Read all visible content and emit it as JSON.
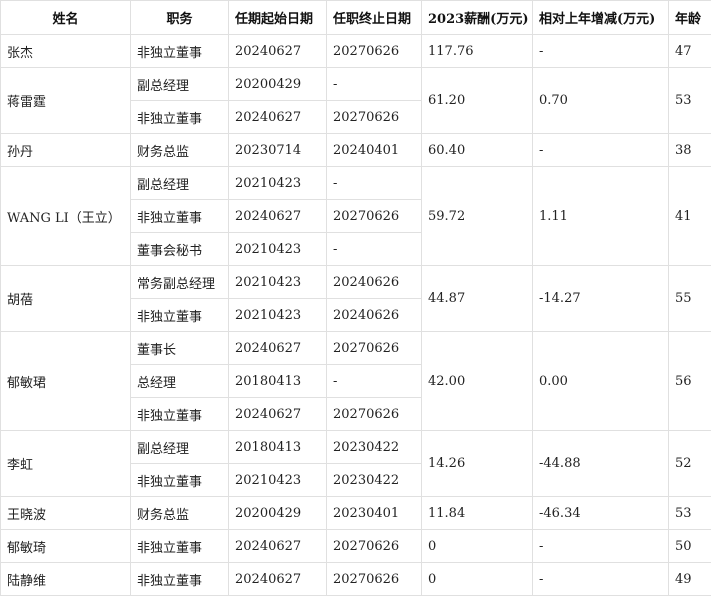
{
  "table": {
    "headers": [
      "姓名",
      "职务",
      "任期起始日期",
      "任职终止日期",
      "2023薪酬(万元)",
      "相对上年增减(万元)",
      "年龄"
    ],
    "people": [
      {
        "name": "张杰",
        "salary": "117.76",
        "change": "-",
        "age": "47",
        "roles": [
          {
            "title": "非独立董事",
            "start": "20240627",
            "end": "20270626"
          }
        ]
      },
      {
        "name": "蒋雷霆",
        "salary": "61.20",
        "change": "0.70",
        "age": "53",
        "roles": [
          {
            "title": "副总经理",
            "start": "20200429",
            "end": "-"
          },
          {
            "title": "非独立董事",
            "start": "20240627",
            "end": "20270626"
          }
        ]
      },
      {
        "name": "孙丹",
        "salary": "60.40",
        "change": "-",
        "age": "38",
        "roles": [
          {
            "title": "财务总监",
            "start": "20230714",
            "end": "20240401"
          }
        ]
      },
      {
        "name": "WANG LI（王立）",
        "salary": "59.72",
        "change": "1.11",
        "age": "41",
        "roles": [
          {
            "title": "副总经理",
            "start": "20210423",
            "end": "-"
          },
          {
            "title": "非独立董事",
            "start": "20240627",
            "end": "20270626"
          },
          {
            "title": "董事会秘书",
            "start": "20210423",
            "end": "-"
          }
        ]
      },
      {
        "name": "胡蓓",
        "salary": "44.87",
        "change": "-14.27",
        "age": "55",
        "roles": [
          {
            "title": "常务副总经理",
            "start": "20210423",
            "end": "20240626"
          },
          {
            "title": "非独立董事",
            "start": "20210423",
            "end": "20240626"
          }
        ]
      },
      {
        "name": "郁敏珺",
        "salary": "42.00",
        "change": "0.00",
        "age": "56",
        "roles": [
          {
            "title": "董事长",
            "start": "20240627",
            "end": "20270626"
          },
          {
            "title": "总经理",
            "start": "20180413",
            "end": "-"
          },
          {
            "title": "非独立董事",
            "start": "20240627",
            "end": "20270626"
          }
        ]
      },
      {
        "name": "李虹",
        "salary": "14.26",
        "change": "-44.88",
        "age": "52",
        "roles": [
          {
            "title": "副总经理",
            "start": "20180413",
            "end": "20230422"
          },
          {
            "title": "非独立董事",
            "start": "20210423",
            "end": "20230422"
          }
        ]
      },
      {
        "name": "王晓波",
        "salary": "11.84",
        "change": "-46.34",
        "age": "53",
        "roles": [
          {
            "title": "财务总监",
            "start": "20200429",
            "end": "20230401"
          }
        ]
      },
      {
        "name": "郁敏琦",
        "salary": "0",
        "change": "-",
        "age": "50",
        "roles": [
          {
            "title": "非独立董事",
            "start": "20240627",
            "end": "20270626"
          }
        ]
      },
      {
        "name": "陆静维",
        "salary": "0",
        "change": "-",
        "age": "49",
        "roles": [
          {
            "title": "非独立董事",
            "start": "20240627",
            "end": "20270626"
          }
        ]
      }
    ]
  }
}
